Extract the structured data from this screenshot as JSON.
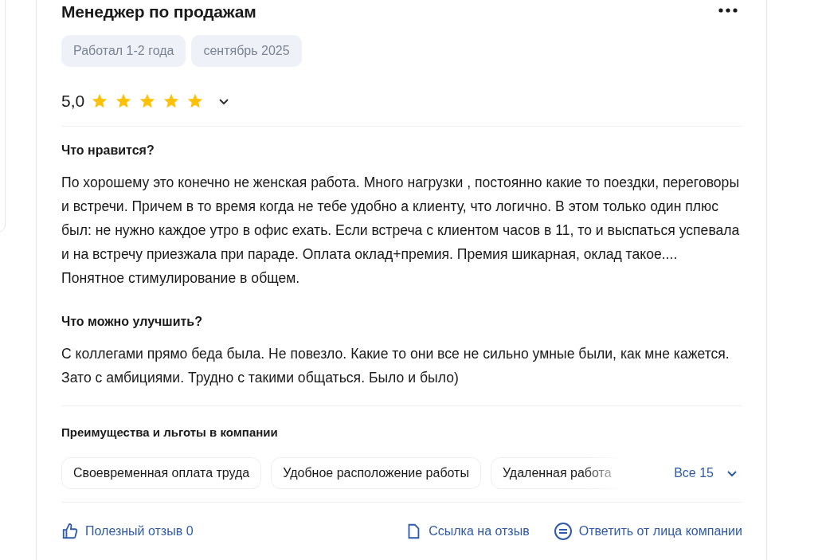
{
  "review": {
    "title": "Менеджер по продажам",
    "tags": [
      "Работал 1-2 года",
      "сентябрь 2025"
    ],
    "rating": {
      "value": "5,0",
      "stars": 5
    },
    "sections": [
      {
        "heading": "Что нравится?",
        "text": "По хорошему это конечно не женская работа. Много нагрузки , постоянно какие то поездки, переговоры и встречи. Причем в то время когда не тебе удобно а клиенту, что логично. В этом только один плюс был: не нужно каждое утро в офис ехать. Если встреча с клиентом часов в 11, то и выспаться успевала и на встречу приезжала при параде. Оплата оклад+премия. Премия шикарная, оклад такое.... Понятное стимулирование в общем."
      },
      {
        "heading": "Что можно улучшить?",
        "text": "С коллегами прямо беда была. Не повезло. Какие то они все не сильно умные были, как мне кажется. Зато с амбициями. Трудно с такими общаться. Было и было)"
      }
    ],
    "benefits": {
      "title": "Преимущества и льготы в компании",
      "items": [
        "Своевременная оплата труда",
        "Удобное расположение работы",
        "Удаленная работа"
      ],
      "more": "Все 15"
    },
    "actions": [
      {
        "kind": "like",
        "label": "Полезный отзыв 0"
      },
      {
        "kind": "link",
        "label": "Ссылка на отзыв"
      },
      {
        "kind": "reply",
        "label": "Ответить от лица компании"
      }
    ]
  }
}
